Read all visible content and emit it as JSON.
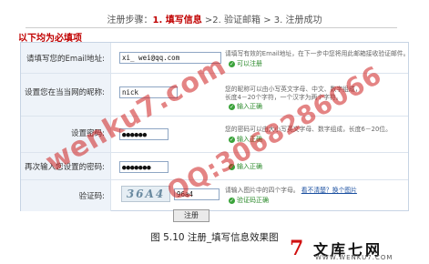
{
  "steps": {
    "label": "注册步骤：",
    "step1": "1. 填写信息",
    "sep1": " >",
    "step2": "2. 验证邮箱",
    "sep2": " > ",
    "step3": "3. 注册成功"
  },
  "required_note": "以下均为必填项",
  "form": {
    "email": {
      "label": "请填写您的Email地址:",
      "value": "xi_   wei@qq.com",
      "hint": "请填写有效的Email地址，在下一步中您将用此邮箱接收验证邮件。",
      "status": "可以注册"
    },
    "nickname": {
      "label": "设置您在当当网的昵称:",
      "value": "nick",
      "hint1": "您的昵称可以由小写英文字母、中文、数字组成，",
      "hint2": "长度4－20个字符，一个汉字为两个字符。",
      "status": "输入正确"
    },
    "password": {
      "label": "设置密码:",
      "value": "●●●●●●",
      "hint": "您的密码可以由大小写英文字母、数字组成，长度6－20位。",
      "status": "输入正确"
    },
    "confirm": {
      "label": "再次输入您设置的密码:",
      "value": "●●●●●●●",
      "status": "输入正确"
    },
    "captcha": {
      "label": "验证码:",
      "image_text": "36A4",
      "value": "96a4",
      "hint": "请输入图片中的四个字母。",
      "link": "看不清楚？换个图片",
      "status": "验证码正确"
    },
    "submit_label": "注册"
  },
  "caption": "图  5.10 注册_填写信息效果图",
  "watermark": {
    "text1": "wenku7.com",
    "text2": "QQ:3068286066"
  },
  "logo": {
    "mark": "7",
    "name": "文库七网",
    "url": "WWW.WENKU7.COM"
  },
  "colors": {
    "accent_red": "#c00000",
    "ok_green": "#2a8a2a",
    "label_bg": "#eef3f9",
    "border": "#c7d4e4"
  }
}
